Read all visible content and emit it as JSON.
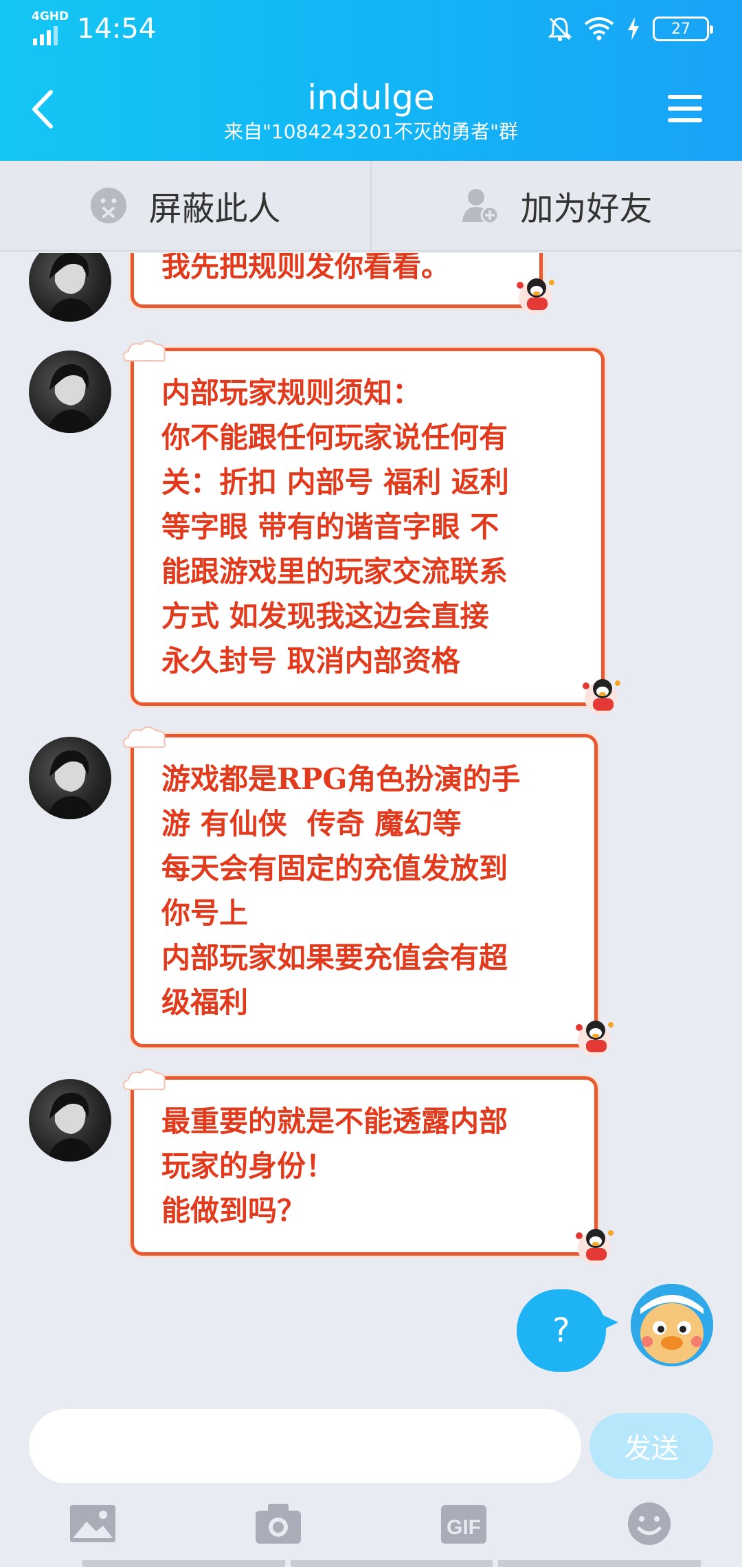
{
  "status": {
    "network": "4GHD",
    "time": "14:54",
    "battery": "27"
  },
  "header": {
    "title": "indulge",
    "subtitle": "来自\"1084243201不灭的勇者\"群"
  },
  "actions": {
    "block": "屏蔽此人",
    "add_friend": "加为好友"
  },
  "messages": [
    {
      "text": "我先把规则发你看看。"
    },
    {
      "text": "内部玩家规则须知：\n你不能跟任何玩家说任何有\n关：折扣 内部号 福利 返利\n等字眼 带有的谐音字眼 不\n能跟游戏里的玩家交流联系\n方式 如发现我这边会直接\n永久封号 取消内部资格"
    },
    {
      "text": "游戏都是RPG角色扮演的手\n游 有仙侠  传奇 魔幻等\n每天会有固定的充值发放到\n你号上\n内部玩家如果要充值会有超\n级福利"
    },
    {
      "text": "最重要的就是不能透露内部\n玩家的身份！\n能做到吗？"
    }
  ],
  "my_message": {
    "text": "?"
  },
  "input": {
    "value": "",
    "placeholder": "",
    "send_label": "发送"
  },
  "toolbar": {
    "gif_label": "GIF"
  },
  "colors": {
    "header_start": "#14c6f4",
    "header_end": "#1aa3f7",
    "bubble_border": "#e9592f",
    "bubble_text": "#e13a1c",
    "my_bubble": "#1db3f5"
  }
}
